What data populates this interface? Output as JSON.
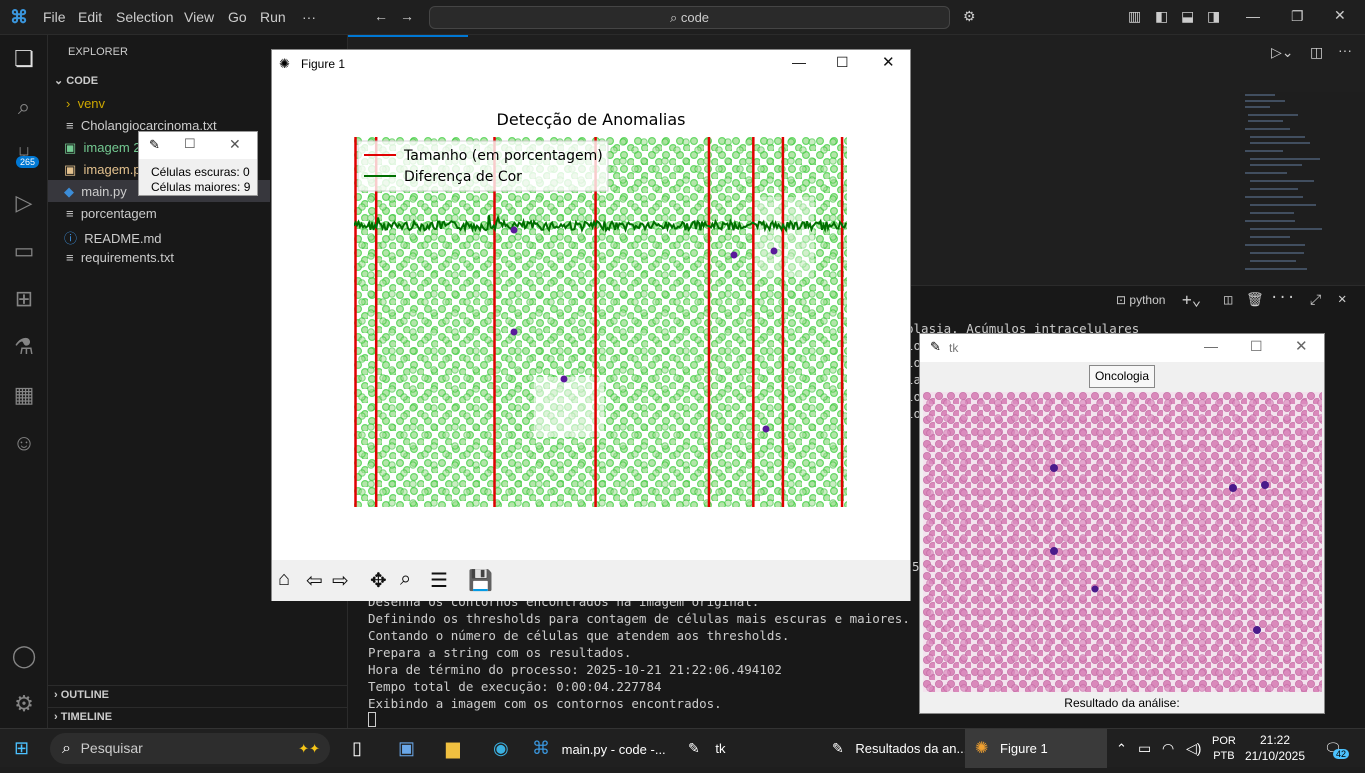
{
  "vscode": {
    "menu": [
      "File",
      "Edit",
      "Selection",
      "View",
      "Go",
      "Run",
      "···"
    ],
    "search": "code",
    "badge_count": "265",
    "explorer_title": "EXPLORER",
    "folder": "CODE",
    "files": [
      "venv",
      "Cholangiocarcinoma.txt",
      "imagem 2",
      "imagem.p",
      "main.py",
      "porcentagem",
      "README.md",
      "requirements.txt"
    ],
    "outline": "OUTLINE",
    "timeline": "TIMELINE",
    "terminal_tab": "python",
    "terminal_right_fragments": [
      "plasia. Acúmulos intracelulares",
      "lo",
      "lo",
      "la",
      "lo",
      "lo",
      "5"
    ],
    "terminal_lines": [
      "Desenha os contornos encontrados na imagem original.",
      "Definindo os thresholds para contagem de células mais escuras e maiores.",
      "Contando o número de células que atendem aos thresholds.",
      "Prepara a string com os resultados.",
      "Hora de término do processo: 2025-10-21 21:22:06.494102",
      "Tempo total de execução: 0:00:04.227784",
      "Exibindo a imagem com os contornos encontrados."
    ]
  },
  "small_popup": {
    "line1": "Células escuras: 0",
    "line2": "Células maiores: 9"
  },
  "figure": {
    "window_title": "Figure 1",
    "chart_data": {
      "type": "line",
      "title": "Detecção de Anomalias",
      "legend": [
        "Tamanho (em porcentagem)",
        "Diferença de Cor"
      ],
      "legend_colors": [
        "#e00000",
        "#007000"
      ],
      "legend_position": "top-left",
      "background": "cell image with green contours",
      "red_vertical_line_positions_fraction": [
        0.0,
        0.045,
        0.285,
        0.49,
        0.72,
        0.81,
        0.87,
        0.99
      ],
      "green_series_level_fraction": 0.24
    }
  },
  "tk": {
    "title": "tk",
    "button": "Oncologia",
    "result_label": "Resultado da análise:"
  },
  "taskbar": {
    "search": "Pesquisar",
    "apps": [
      "main.py - code -...",
      "tk",
      "Resultados da an...",
      "Figure 1"
    ],
    "lang1": "POR",
    "lang2": "PTB",
    "time": "21:22",
    "date": "21/10/2025",
    "notif": "42"
  }
}
